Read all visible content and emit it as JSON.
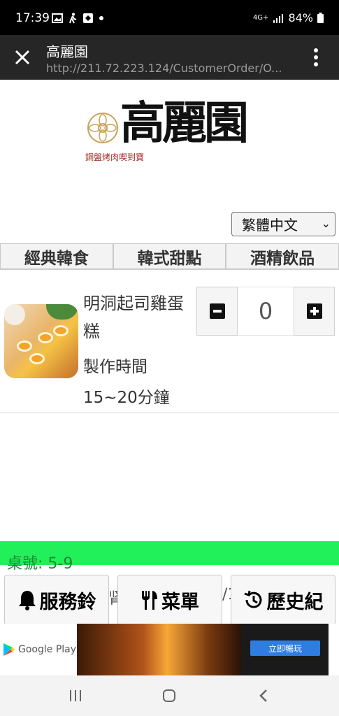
{
  "status_bar": {
    "time": "17:39",
    "network": "4G+",
    "battery": "84%",
    "icons": [
      "gallery-icon",
      "walking-icon",
      "app-icon",
      "dot-icon",
      "signal-icon",
      "battery-icon"
    ]
  },
  "browser": {
    "title": "高麗園",
    "url": "http://211.72.223.124/CustomerOrder/O...",
    "icons": [
      "close-icon",
      "more-vert-icon"
    ]
  },
  "logo": {
    "name": "高麗園",
    "subtitle": "鋼盤烤肉喫到寶"
  },
  "language_select": {
    "selected": "繁體中文",
    "icon": "chevron-down-icon"
  },
  "tabs": [
    {
      "label": "經典韓食"
    },
    {
      "label": "韓式甜點"
    },
    {
      "label": "酒精飲品"
    }
  ],
  "product": {
    "name": "明洞起司雞蛋糕",
    "time_label": "製作時間",
    "time_value": "15~20分鐘",
    "quantity": "0"
  },
  "table_info": {
    "label": "桌號: 5-9"
  },
  "bottom_buttons": [
    {
      "label": "服務鈴",
      "icon": "bell-icon"
    },
    {
      "label": "菜單",
      "icon": "utensils-icon"
    },
    {
      "label": "歷史紀",
      "icon": "history-icon"
    }
  ],
  "behind_text": {
    "left": "肾",
    "right": "/1"
  },
  "ad": {
    "brand": "Google Play",
    "cta": "立即暢玩"
  },
  "nav_bar": {
    "icons": [
      "recent-apps-icon",
      "home-icon",
      "back-icon"
    ]
  },
  "colors": {
    "status_bar": "#000000",
    "browser_bar": "#262626",
    "table_bar": "#22f05a",
    "ad_cta": "#2f7de1"
  }
}
